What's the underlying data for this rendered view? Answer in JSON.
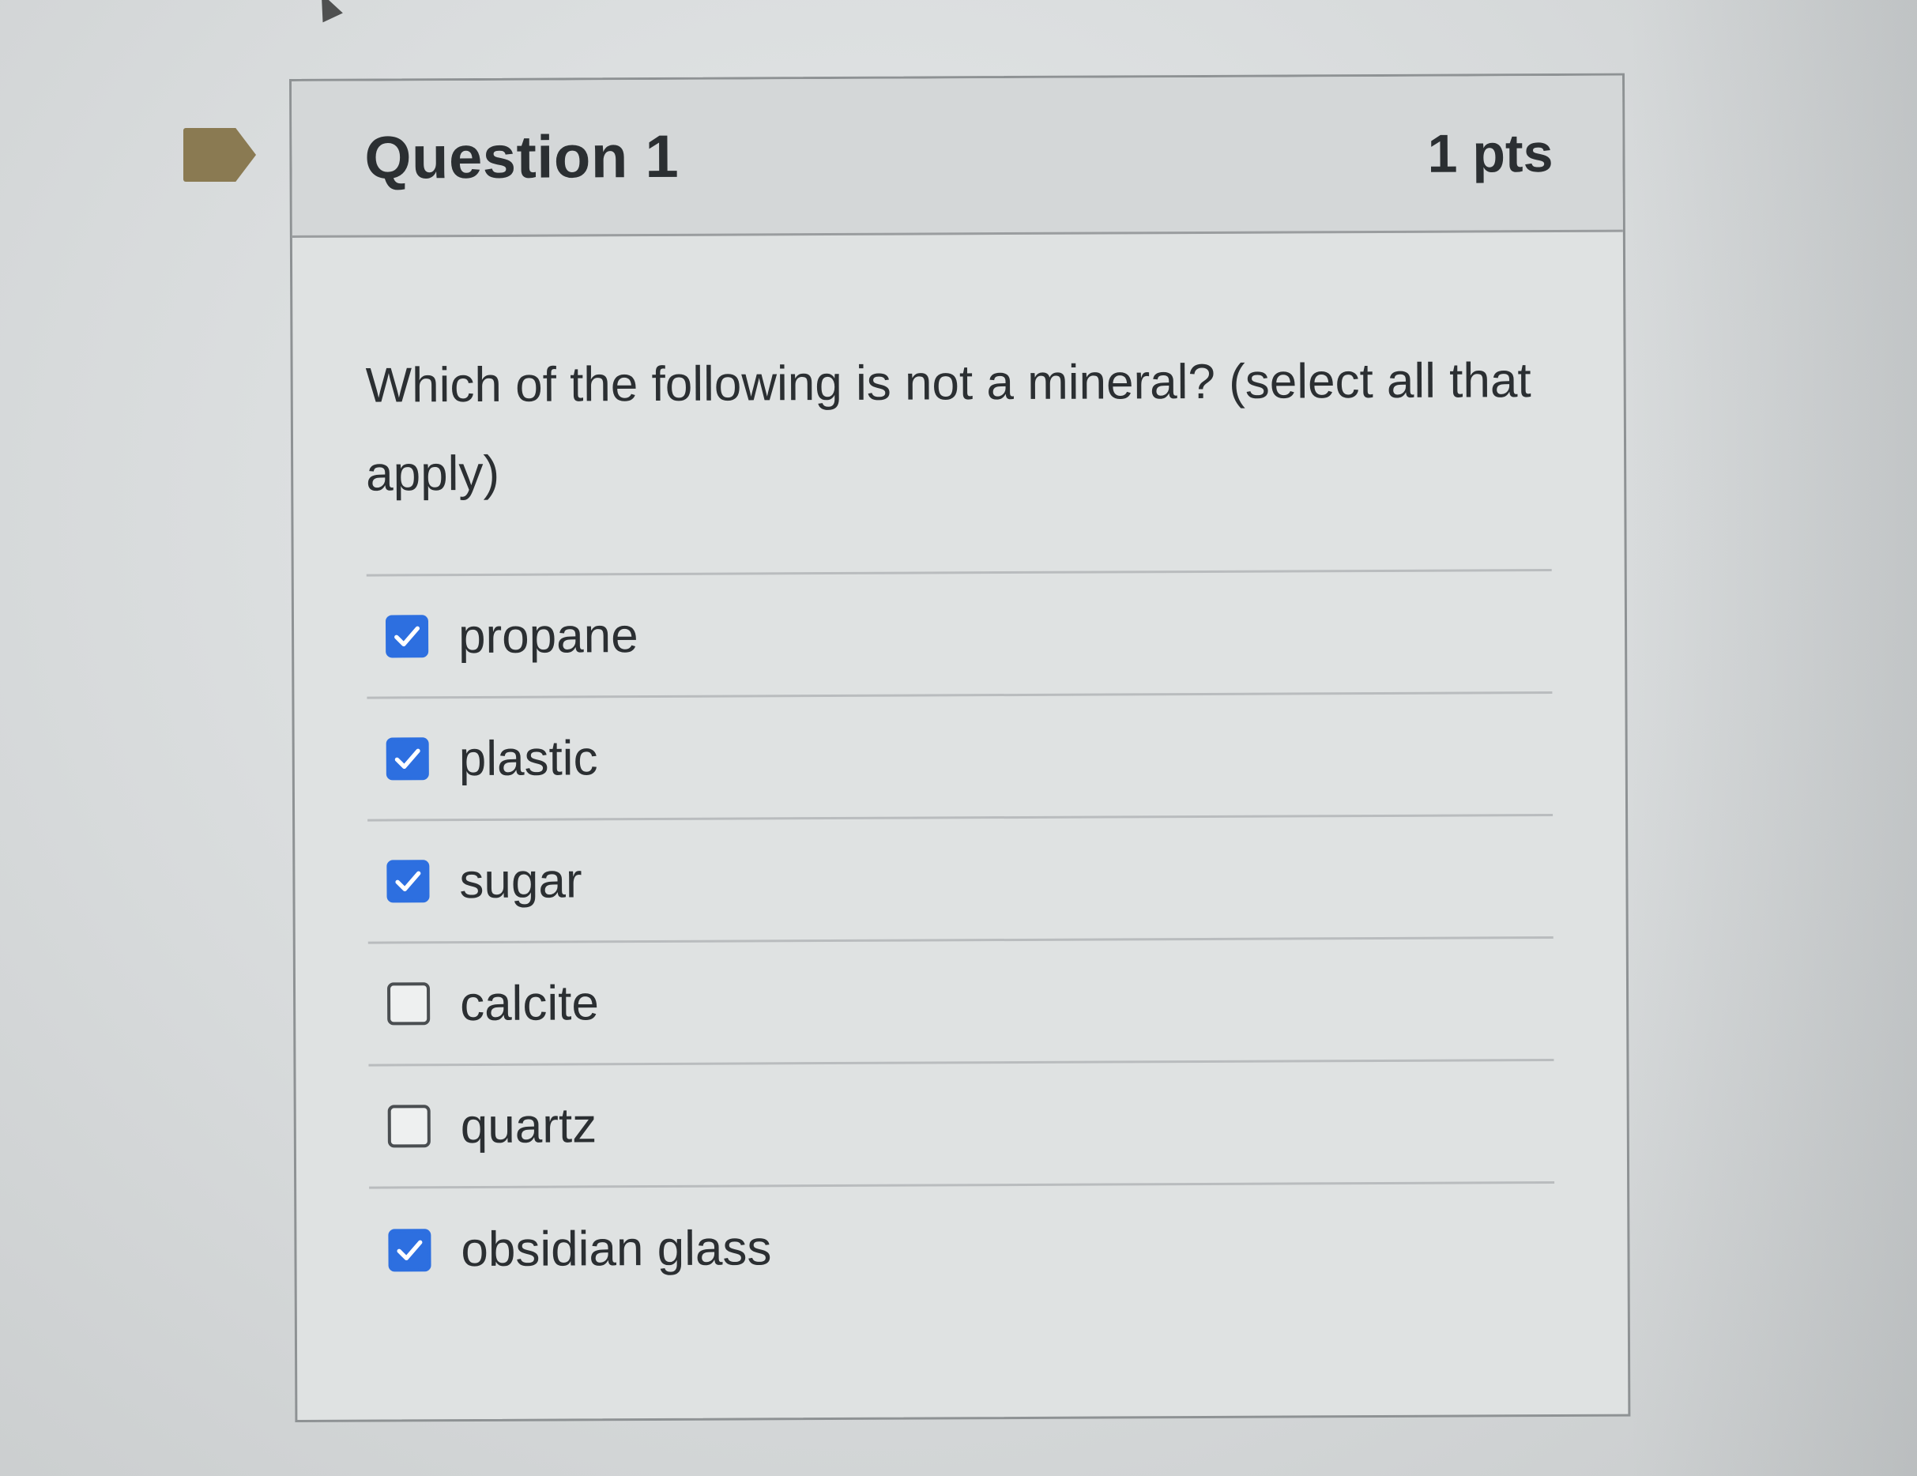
{
  "question": {
    "title": "Question 1",
    "points": "1 pts",
    "text": "Which of the following is not a mineral? (select all that apply)"
  },
  "answers": [
    {
      "label": "propane",
      "checked": true
    },
    {
      "label": "plastic",
      "checked": true
    },
    {
      "label": "sugar",
      "checked": true
    },
    {
      "label": "calcite",
      "checked": false
    },
    {
      "label": "quartz",
      "checked": false
    },
    {
      "label": "obsidian glass",
      "checked": true
    }
  ],
  "colors": {
    "checkbox_checked": "#2d6fe0",
    "flag": "#8a7a52",
    "text": "#2b2f32"
  }
}
